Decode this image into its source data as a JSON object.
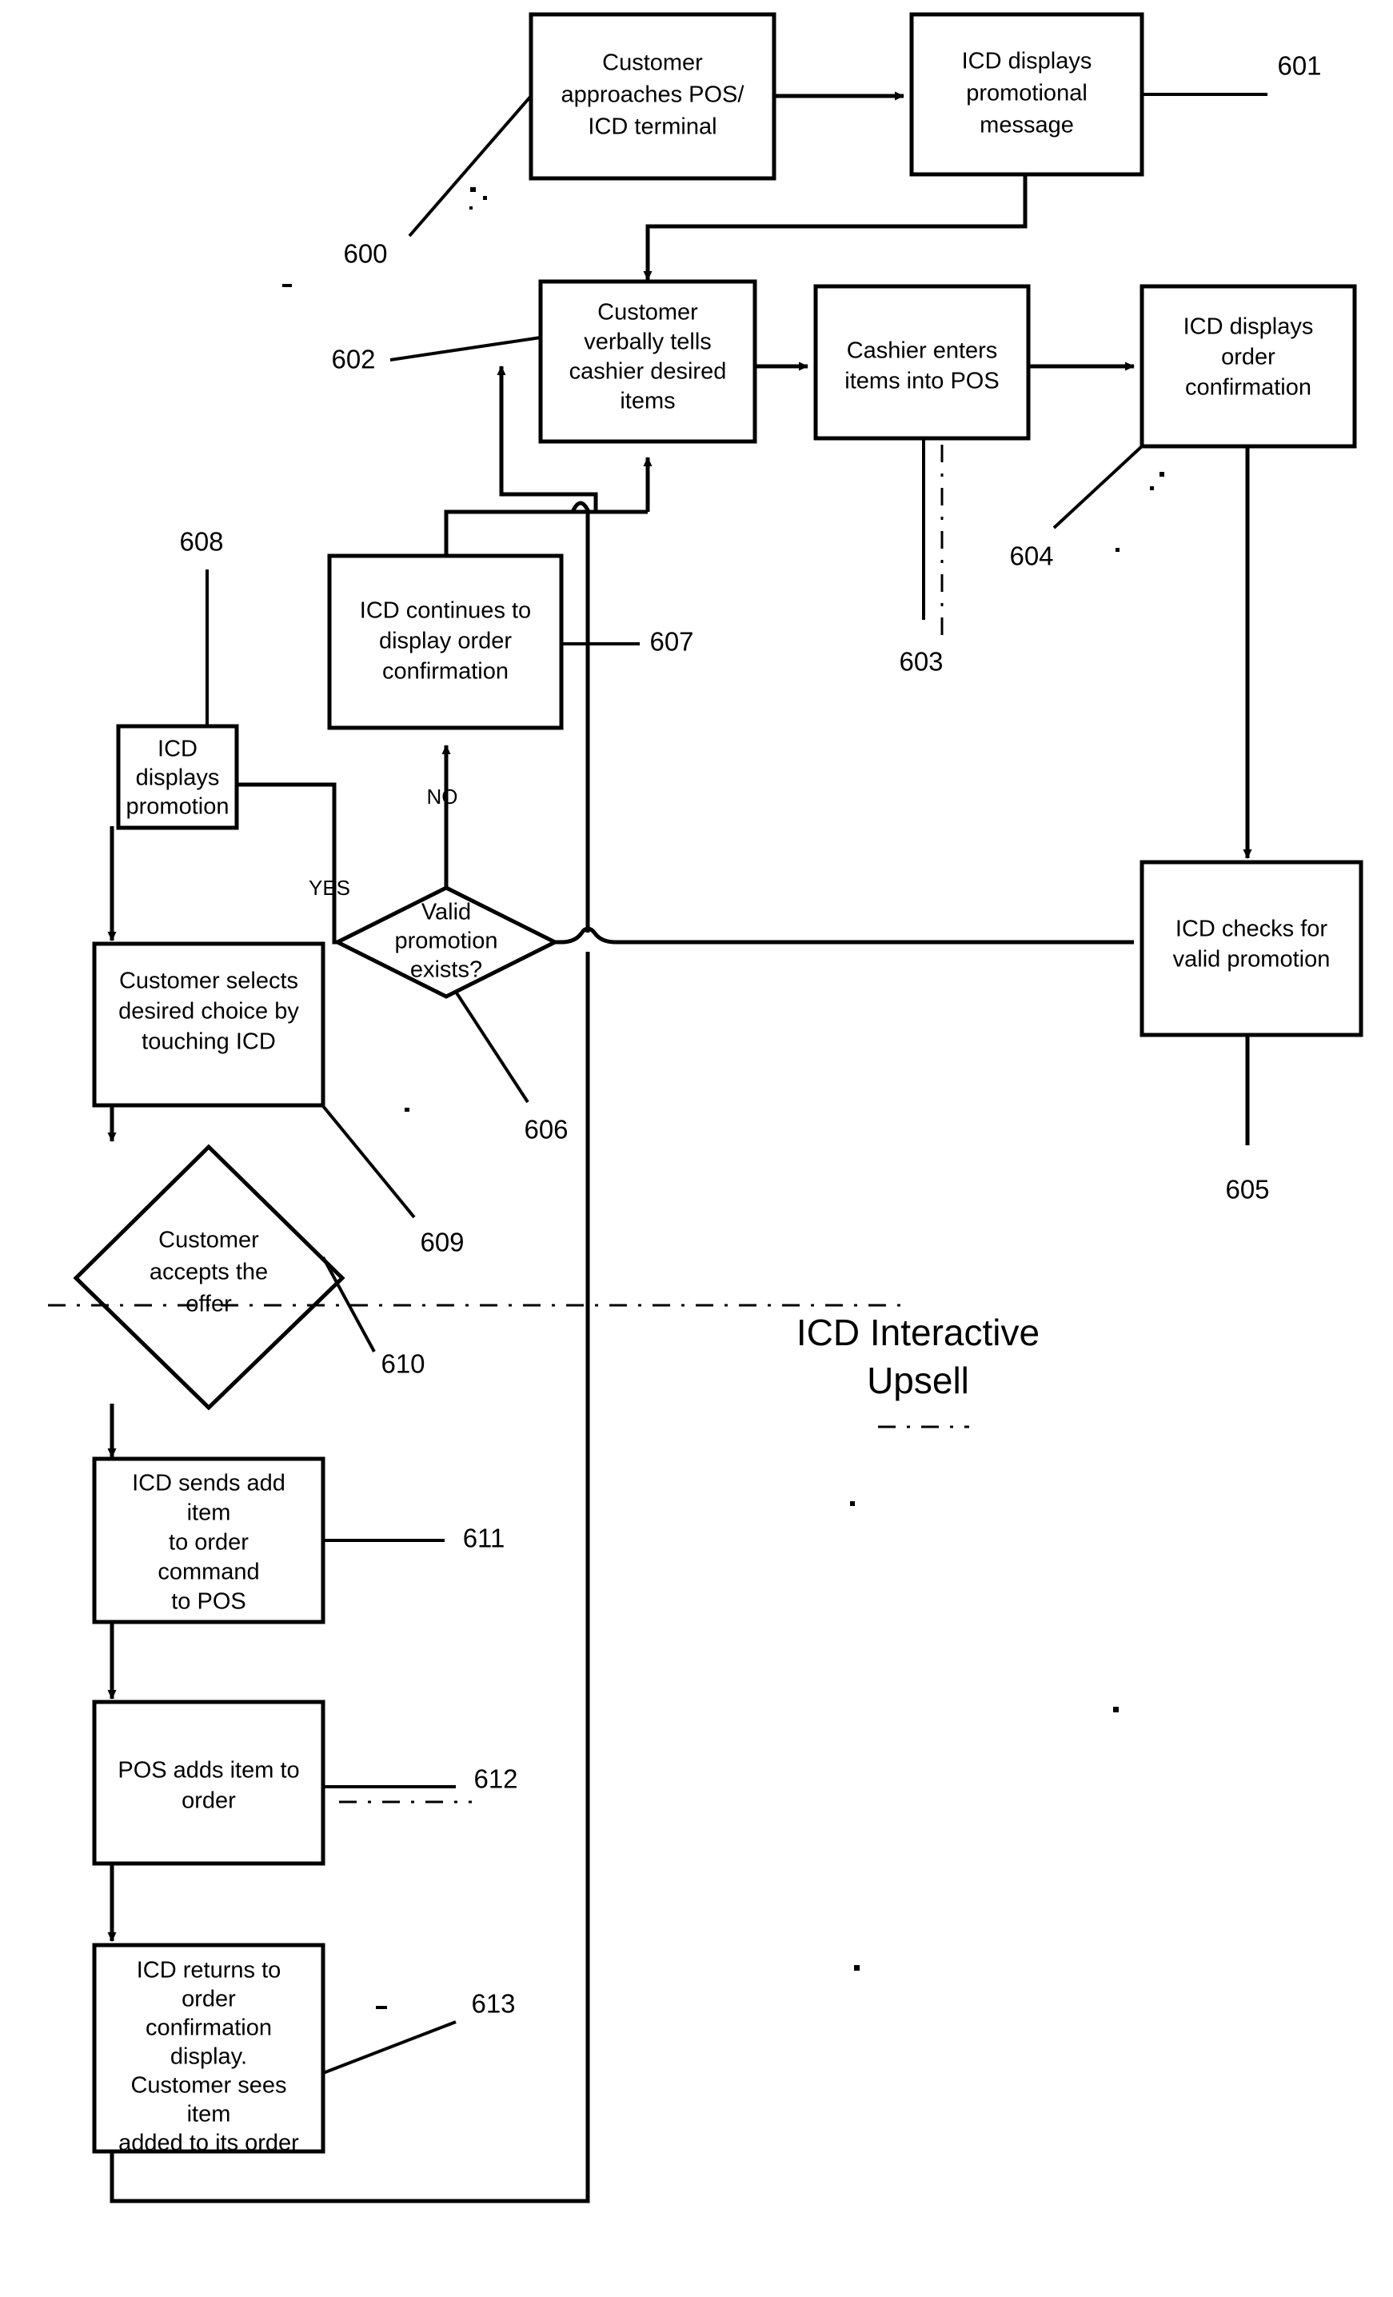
{
  "figure": {
    "title_line1": "ICD Interactive",
    "title_line2": "Upsell"
  },
  "nodes": [
    {
      "id": "n600",
      "shape": "process",
      "ref": "600",
      "lines": [
        "Customer",
        "approaches POS/",
        "ICD terminal"
      ]
    },
    {
      "id": "n601",
      "shape": "process",
      "ref": "601",
      "lines": [
        "ICD displays",
        "promotional",
        "message"
      ]
    },
    {
      "id": "n602",
      "shape": "process",
      "ref": "602",
      "lines": [
        "Customer",
        "verbally tells",
        "cashier desired",
        "items"
      ]
    },
    {
      "id": "n603",
      "shape": "process",
      "ref": "603",
      "lines": [
        "Cashier enters",
        "items into POS"
      ]
    },
    {
      "id": "n604",
      "shape": "process",
      "ref": "604",
      "lines": [
        "ICD displays",
        "order",
        "confirmation"
      ]
    },
    {
      "id": "n605",
      "shape": "process",
      "ref": "605",
      "lines": [
        "ICD checks for",
        "valid promotion"
      ]
    },
    {
      "id": "n606",
      "shape": "decision",
      "ref": "606",
      "lines": [
        "Valid",
        "promotion",
        "exists?"
      ]
    },
    {
      "id": "n607",
      "shape": "process",
      "ref": "607",
      "lines": [
        "ICD continues to",
        "display order",
        "confirmation"
      ]
    },
    {
      "id": "n608",
      "shape": "process",
      "ref": "608",
      "lines": [
        "ICD",
        "displays",
        "promotion"
      ]
    },
    {
      "id": "n609",
      "shape": "process",
      "ref": "609",
      "lines": [
        "Customer selects",
        "desired choice by",
        "touching ICD"
      ]
    },
    {
      "id": "n610",
      "shape": "decision",
      "ref": "610",
      "lines": [
        "Customer",
        "accepts the",
        "offer"
      ]
    },
    {
      "id": "n611",
      "shape": "process",
      "ref": "611",
      "lines": [
        "ICD sends add",
        "item",
        "to order",
        "command",
        "to POS"
      ]
    },
    {
      "id": "n612",
      "shape": "process",
      "ref": "612",
      "lines": [
        "POS adds item to",
        "order"
      ]
    },
    {
      "id": "n613",
      "shape": "process",
      "ref": "613",
      "lines": [
        "ICD returns to",
        "order",
        "confirmation",
        "display.",
        "Customer sees",
        "item",
        "added to its order"
      ]
    }
  ],
  "branch_labels": {
    "no": "NO",
    "yes": "YES"
  },
  "colors": {
    "ink": "#000000",
    "paper": "#ffffff"
  }
}
